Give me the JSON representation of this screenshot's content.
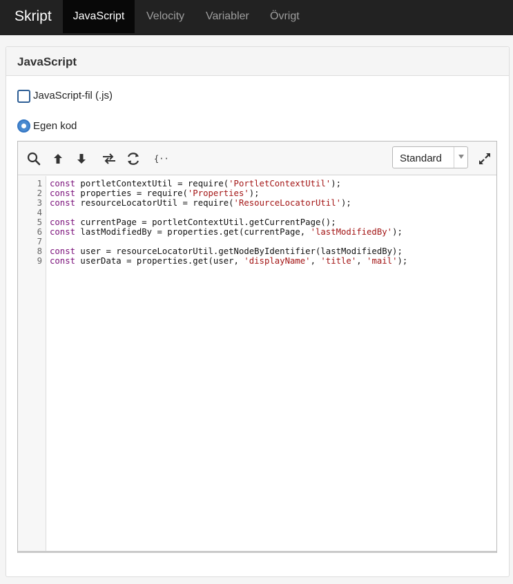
{
  "topnav": {
    "brand": "Skript",
    "tabs": [
      {
        "label": "JavaScript",
        "active": true
      },
      {
        "label": "Velocity",
        "active": false
      },
      {
        "label": "Variabler",
        "active": false
      },
      {
        "label": "Övrigt",
        "active": false
      }
    ]
  },
  "panel": {
    "title": "JavaScript",
    "file_option_label": "JavaScript-fil (.js)",
    "file_option_checked": false,
    "custom_code_label": "Egen kod",
    "custom_code_selected": true
  },
  "editor": {
    "toolbar": {
      "icons": [
        "search-icon",
        "arrow-up-icon",
        "arrow-down-icon",
        "replace-icon",
        "refresh-icon",
        "format-code-icon",
        "fullscreen-icon"
      ],
      "theme_select_value": "Standard"
    },
    "lines": [
      {
        "num": "1",
        "tokens": [
          {
            "t": "kw",
            "v": "const"
          },
          {
            "t": "plain",
            "v": " portletContextUtil = require("
          },
          {
            "t": "str",
            "v": "'PortletContextUtil'"
          },
          {
            "t": "plain",
            "v": ");"
          }
        ]
      },
      {
        "num": "2",
        "tokens": [
          {
            "t": "kw",
            "v": "const"
          },
          {
            "t": "plain",
            "v": " properties = require("
          },
          {
            "t": "str",
            "v": "'Properties'"
          },
          {
            "t": "plain",
            "v": ");"
          }
        ]
      },
      {
        "num": "3",
        "tokens": [
          {
            "t": "kw",
            "v": "const"
          },
          {
            "t": "plain",
            "v": " resourceLocatorUtil = require("
          },
          {
            "t": "str",
            "v": "'ResourceLocatorUtil'"
          },
          {
            "t": "plain",
            "v": ");"
          }
        ]
      },
      {
        "num": "4",
        "tokens": []
      },
      {
        "num": "5",
        "tokens": [
          {
            "t": "kw",
            "v": "const"
          },
          {
            "t": "plain",
            "v": " currentPage = portletContextUtil.getCurrentPage();"
          }
        ]
      },
      {
        "num": "6",
        "tokens": [
          {
            "t": "kw",
            "v": "const"
          },
          {
            "t": "plain",
            "v": " lastModifiedBy = properties.get(currentPage, "
          },
          {
            "t": "str",
            "v": "'lastModifiedBy'"
          },
          {
            "t": "plain",
            "v": ");"
          }
        ]
      },
      {
        "num": "7",
        "tokens": []
      },
      {
        "num": "8",
        "tokens": [
          {
            "t": "kw",
            "v": "const"
          },
          {
            "t": "plain",
            "v": " user = resourceLocatorUtil.getNodeByIdentifier(lastModifiedBy);"
          }
        ]
      },
      {
        "num": "9",
        "tokens": [
          {
            "t": "kw",
            "v": "const"
          },
          {
            "t": "plain",
            "v": " userData = properties.get(user, "
          },
          {
            "t": "str",
            "v": "'displayName'"
          },
          {
            "t": "plain",
            "v": ", "
          },
          {
            "t": "str",
            "v": "'title'"
          },
          {
            "t": "plain",
            "v": ", "
          },
          {
            "t": "str",
            "v": "'mail'"
          },
          {
            "t": "plain",
            "v": ");"
          }
        ]
      }
    ]
  },
  "colors": {
    "navbar": "#222222",
    "active_tab": "#080808",
    "keyword": "#7a0f7a",
    "string": "#a31515",
    "radio": "#4a8ad0"
  }
}
